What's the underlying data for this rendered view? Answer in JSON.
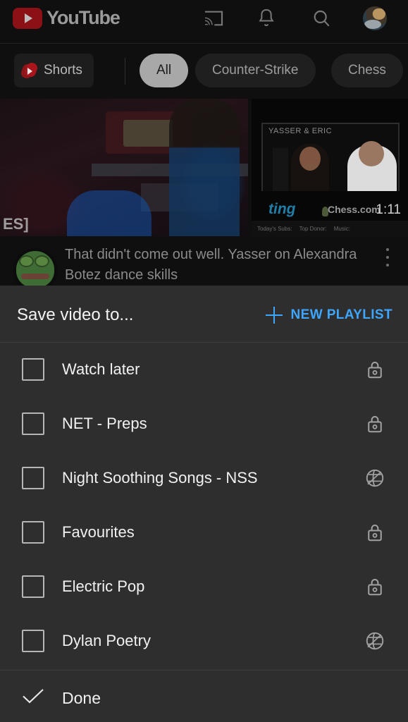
{
  "app": {
    "brand": "YouTube",
    "logo_icon": "youtube-logo-icon"
  },
  "header": {
    "icons": [
      {
        "name": "cast-icon",
        "label": "Cast"
      },
      {
        "name": "bell-icon",
        "label": "Notifications"
      },
      {
        "name": "search-icon",
        "label": "Search"
      },
      {
        "name": "avatar",
        "label": "Account"
      }
    ]
  },
  "chips_bar": {
    "shorts_button": {
      "label": "Shorts",
      "icon": "shorts-icon"
    },
    "chips": [
      {
        "label": "All",
        "selected": true
      },
      {
        "label": "Counter-Strike",
        "selected": false
      },
      {
        "label": "Chess",
        "selected": false
      }
    ]
  },
  "feed": {
    "thumbnail_left": {
      "watermark": "ES]"
    },
    "thumbnail_right": {
      "overlay_label": "YASSER & ERIC",
      "sponsor": "ting",
      "brand": "Chess.com",
      "duration": "1:11",
      "strip": [
        "Today's Subs:",
        "Top Donor:",
        "Music:"
      ]
    },
    "video": {
      "title": "That didn't come out well. Yasser on Alexandra Botez dance skills",
      "channel_avatar": "frog-avatar",
      "overflow_icon": "more-vertical-icon"
    }
  },
  "dialog": {
    "title": "Save video to...",
    "new_playlist": {
      "label": "NEW PLAYLIST",
      "icon": "plus-icon",
      "color": "#3ea6ff"
    },
    "playlists": [
      {
        "name": "Watch later",
        "checked": false,
        "privacy": "private"
      },
      {
        "name": "NET - Preps",
        "checked": false,
        "privacy": "private"
      },
      {
        "name": "Night Soothing Songs - NSS",
        "checked": false,
        "privacy": "public"
      },
      {
        "name": "Favourites",
        "checked": false,
        "privacy": "private"
      },
      {
        "name": "Electric Pop",
        "checked": false,
        "privacy": "private"
      },
      {
        "name": "Dylan Poetry",
        "checked": false,
        "privacy": "public"
      }
    ],
    "done": {
      "label": "Done",
      "icon": "check-icon"
    }
  },
  "theme": {
    "background": "#0f0f0f",
    "dialog_background": "#2e2e2e",
    "accent_blue": "#3ea6ff",
    "brand_red": "#8b1117",
    "text_primary": "#f1f1f1",
    "text_dimmed": "#8a8a8a"
  }
}
